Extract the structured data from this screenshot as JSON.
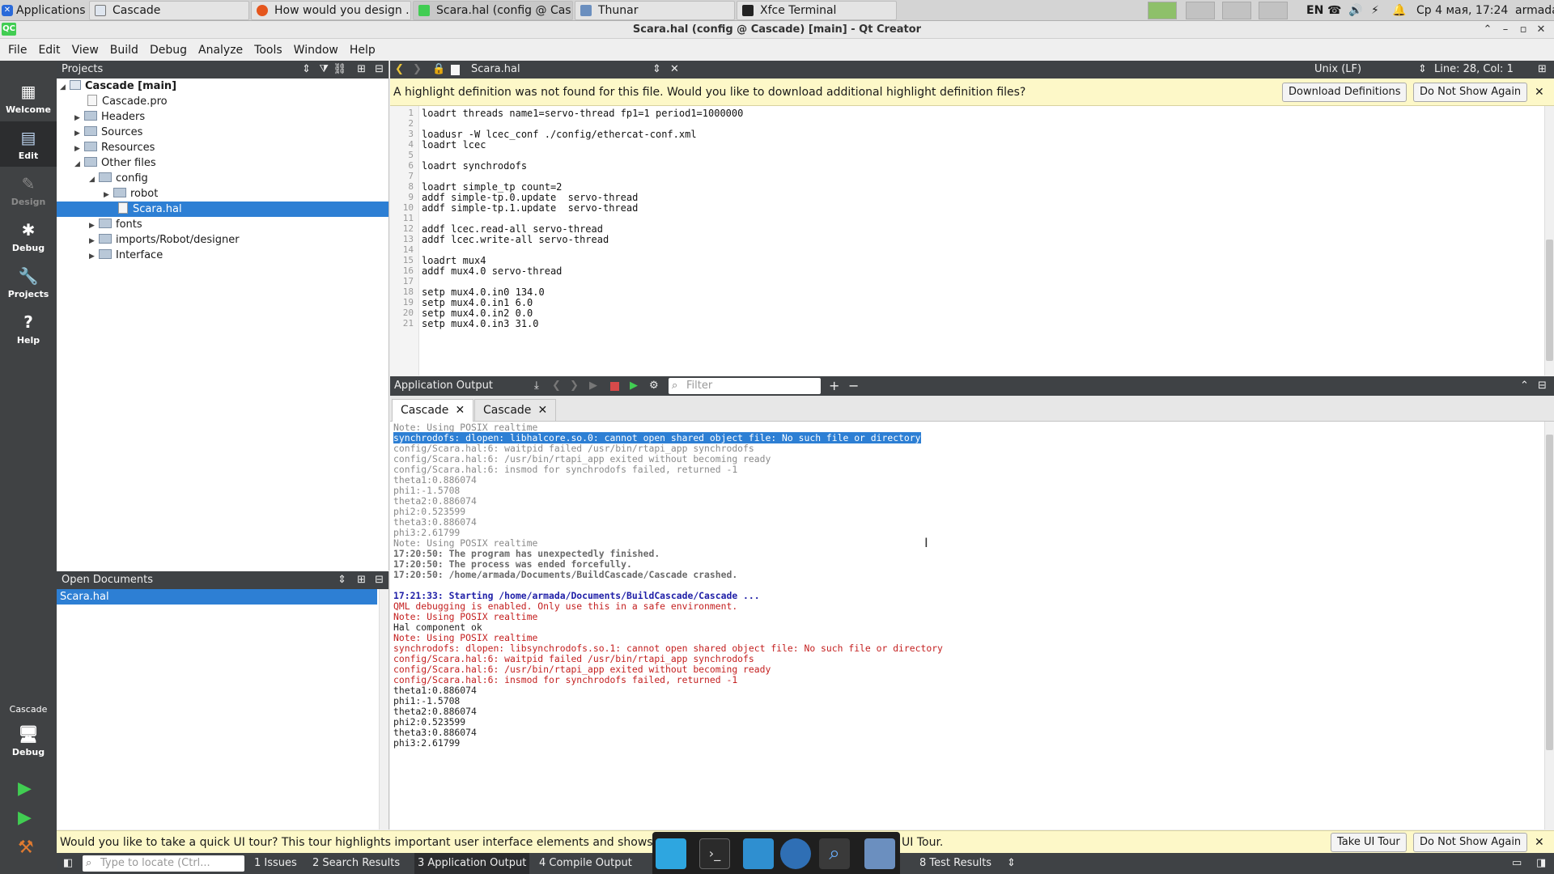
{
  "xfce": {
    "applications": "Applications",
    "tasks": [
      "Cascade",
      "How would you design ...",
      "Scara.hal (config @ Cas...",
      "Thunar",
      "Xfce Terminal"
    ],
    "lang": "EN",
    "clock": "Ср 4 мая, 17:24",
    "user": "armada"
  },
  "window": {
    "title": "Scara.hal (config @ Cascade) [main] - Qt Creator"
  },
  "menu": [
    "File",
    "Edit",
    "View",
    "Build",
    "Debug",
    "Analyze",
    "Tools",
    "Window",
    "Help"
  ],
  "modes": [
    {
      "label": "Welcome",
      "icon": "grid-icon"
    },
    {
      "label": "Edit",
      "icon": "edit-icon"
    },
    {
      "label": "Design",
      "icon": "pencil-icon"
    },
    {
      "label": "Debug",
      "icon": "bug-icon"
    },
    {
      "label": "Projects",
      "icon": "wrench-icon"
    },
    {
      "label": "Help",
      "icon": "help-icon"
    }
  ],
  "kit": {
    "project": "Cascade",
    "config": "Debug"
  },
  "projects": {
    "title": "Projects",
    "tree": [
      "Cascade [main]",
      "Cascade.pro",
      "Headers",
      "Sources",
      "Resources",
      "Other files",
      "config",
      "robot",
      "Scara.hal",
      "fonts",
      "imports/Robot/designer",
      "Interface"
    ]
  },
  "open_documents": {
    "title": "Open Documents",
    "items": [
      "Scara.hal"
    ]
  },
  "editor": {
    "file": "Scara.hal",
    "line_ending": "Unix (LF)",
    "position": "Line: 28, Col: 1",
    "info": "A highlight definition was not found for this file. Would you like to download additional highlight definition files?",
    "download_btn": "Download Definitions",
    "dont_show_btn": "Do Not Show Again",
    "lines": [
      "loadrt threads name1=servo-thread fp1=1 period1=1000000",
      "",
      "loadusr -W lcec_conf ./config/ethercat-conf.xml",
      "loadrt lcec",
      "",
      "loadrt synchrodofs",
      "",
      "loadrt simple_tp count=2",
      "addf simple-tp.0.update  servo-thread",
      "addf simple-tp.1.update  servo-thread",
      "",
      "addf lcec.read-all servo-thread",
      "addf lcec.write-all servo-thread",
      "",
      "loadrt mux4",
      "addf mux4.0 servo-thread",
      "",
      "setp mux4.0.in0 134.0",
      "setp mux4.0.in1 6.0",
      "setp mux4.0.in2 0.0",
      "setp mux4.0.in3 31.0"
    ]
  },
  "output": {
    "title": "Application Output",
    "filter_placeholder": "Filter",
    "tabs": [
      "Cascade",
      "Cascade"
    ],
    "lines": [
      "Note: Using POSIX realtime",
      "synchrodofs: dlopen: libhalcore.so.0: cannot open shared object file: No such file or directory",
      "config/Scara.hal:6: waitpid failed /usr/bin/rtapi_app synchrodofs",
      "config/Scara.hal:6: /usr/bin/rtapi_app exited without becoming ready",
      "config/Scara.hal:6: insmod for synchrodofs failed, returned -1",
      "theta1:0.886074",
      "phi1:-1.5708",
      "theta2:0.886074",
      "phi2:0.523599",
      "theta3:0.886074",
      "phi3:2.61799",
      "Note: Using POSIX realtime",
      "17:20:50: The program has unexpectedly finished.",
      "17:20:50: The process was ended forcefully.",
      "17:20:50: /home/armada/Documents/BuildCascade/Cascade crashed.",
      "",
      "17:21:33: Starting /home/armada/Documents/BuildCascade/Cascade ...",
      "QML debugging is enabled. Only use this in a safe environment.",
      "Note: Using POSIX realtime",
      "Hal component ok",
      "Note: Using POSIX realtime",
      "synchrodofs: dlopen: libsynchrodofs.so.1: cannot open shared object file: No such file or directory",
      "config/Scara.hal:6: waitpid failed /usr/bin/rtapi_app synchrodofs",
      "config/Scara.hal:6: /usr/bin/rtapi_app exited without becoming ready",
      "config/Scara.hal:6: insmod for synchrodofs failed, returned -1",
      "theta1:0.886074",
      "phi1:-1.5708",
      "theta2:0.886074",
      "phi2:0.523599",
      "theta3:0.886074",
      "phi3:2.61799"
    ]
  },
  "tour": {
    "text_start": "Would you like to take a quick UI tour? This tour highlights important user interface elements and shows how the",
    "text_end": "UI Tour.",
    "take_btn": "Take UI Tour",
    "dont_show_btn": "Do Not Show Again"
  },
  "statusbar": {
    "locator_placeholder": "Type to locate (Ctrl...",
    "tabs": [
      "1 Issues",
      "2 Search Results",
      "3 Application Output",
      "4 Compile Output",
      "8 Test Results"
    ]
  }
}
